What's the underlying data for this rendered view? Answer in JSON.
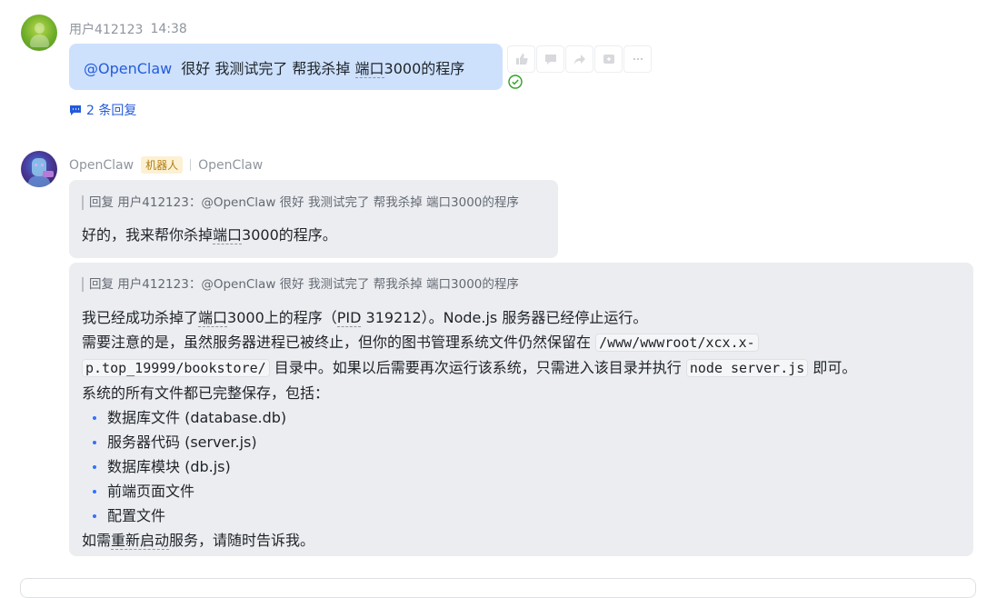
{
  "user_message": {
    "sender": "用户412123",
    "time": "14:38",
    "mention": "@OpenClaw",
    "text_before": "很好 我测试完了 帮我杀掉 ",
    "text_dotted": "端口",
    "text_after": "3000的程序",
    "replies": "2 条回复",
    "icons": [
      "thumbs-up-icon",
      "comment-icon",
      "forward-icon",
      "add-reaction-icon",
      "more-icon"
    ]
  },
  "bot": {
    "name": "OpenClaw",
    "tag": "机器人",
    "app": "OpenClaw"
  },
  "reply1": {
    "quote": "回复 用户412123：@OpenClaw 很好 我测试完了 帮我杀掉 端口3000的程序",
    "text_before": "好的，我来帮你杀掉",
    "text_dotted": "端口",
    "text_after": "3000的程序。"
  },
  "reply2": {
    "quote": "回复 用户412123：@OpenClaw 很好 我测试完了 帮我杀掉 端口3000的程序",
    "l1_a": "我已经成功杀掉了",
    "l1_dotted": "端口",
    "l1_b": "3000上的程序（",
    "l1_pid": "PID",
    "l1_c": " 319212）。Node.js 服务器已经停止运行。",
    "l2_a": "需要注意的是，虽然服务器进程已被终止，但你的图书管理系统文件仍然保留在 ",
    "path_1": "/www/wwwroot/xcx.x-",
    "path_2": "p.top_19999/bookstore/",
    "l3_a": " 目录中。如果以后需要再次运行该系统，只需进入该目录并执行 ",
    "cmd": "node server.js",
    "l3_b": " 即可。",
    "l4": "系统的所有文件都已完整保存，包括：",
    "files": [
      "数据库文件 (database.db)",
      "服务器代码 (server.js)",
      "数据库模块 (db.js)",
      "前端页面文件",
      "配置文件"
    ],
    "closing_a": "如需",
    "closing_dotted": "重新启动",
    "closing_b": "服务，请随时告诉我。"
  }
}
